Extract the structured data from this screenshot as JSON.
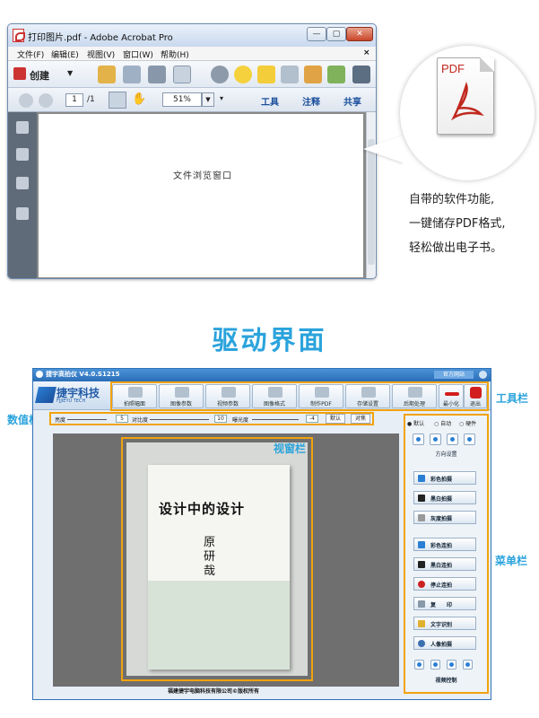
{
  "acrobat": {
    "title": "打印图片.pdf - Adobe Acrobat Pro",
    "window_buttons": [
      "—",
      "▢",
      "✕"
    ],
    "menu": [
      "文件(F)",
      "编辑(E)",
      "视图(V)",
      "窗口(W)",
      "帮助(H)"
    ],
    "create_label": "创建",
    "page_current": "1",
    "page_total": "/1",
    "zoom": "51%",
    "panels": [
      "工具",
      "注释",
      "共享"
    ],
    "doc_text": "文件浏览窗口"
  },
  "callout": {
    "pdf_label": "PDF",
    "lines": [
      "自带的软件功能,",
      "一键储存PDF格式,",
      "轻松做出电子书。"
    ]
  },
  "heading": "驱动界面",
  "app": {
    "title": "捷宇高拍仪 V4.0.S1215",
    "official_site": "官方网站",
    "logo_text": "捷宇科技",
    "logo_sub": "FJJIEYU TECH",
    "toolbar_buttons": [
      "拍照幅面",
      "图像参数",
      "视频参数",
      "图像格式",
      "制作PDF",
      "存储设置",
      "后期处理",
      "最小化",
      "退出"
    ],
    "value_bar": {
      "brightness_label": "亮度",
      "brightness_value": "5",
      "contrast_label": "对比度",
      "contrast_value": "10",
      "exposure_label": "曝光度",
      "exposure_value": "-4",
      "default_btn": "默认",
      "confirm_btn": "对焦"
    },
    "viewport": {
      "book_title": "设计中的设计",
      "book_author": "原研哉"
    },
    "footer": "福建捷宇电脑科技有限公司©版权所有",
    "right_panel": {
      "radios": [
        "默认",
        "自动",
        "硬件"
      ],
      "direction_label": "方向设置",
      "capture_buttons": [
        "彩色拍摄",
        "黑白拍摄",
        "灰度拍摄"
      ],
      "continuous_buttons": [
        "彩色连拍",
        "黑白连拍",
        "停止连拍",
        "复　　印",
        "文字识别",
        "人像拍摄"
      ],
      "video_label": "视频控制"
    }
  },
  "annotations": {
    "toolbar": "工具栏",
    "valuebar": "数值栏",
    "viewport": "视窗栏",
    "menu": "菜单栏"
  },
  "colors": {
    "accent": "#2aa3dc",
    "highlight": "#f2a20c",
    "acrobat_red": "#c0281e"
  }
}
